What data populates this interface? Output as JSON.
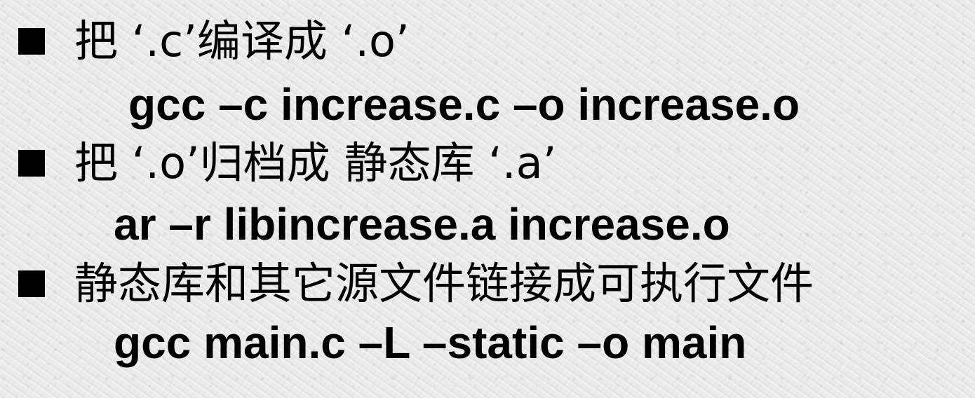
{
  "slide": {
    "items": [
      {
        "bullet": "把 ‘.c’编译成 ‘.o’",
        "command": "gcc –c increase.c –o increase.o"
      },
      {
        "bullet": "把 ‘.o’归档成 静态库 ‘.a’",
        "command": "ar –r  libincrease.a  increase.o"
      },
      {
        "bullet": "静态库和其它源文件链接成可执行文件",
        "command": "gcc main.c –L –static –o main"
      }
    ]
  }
}
